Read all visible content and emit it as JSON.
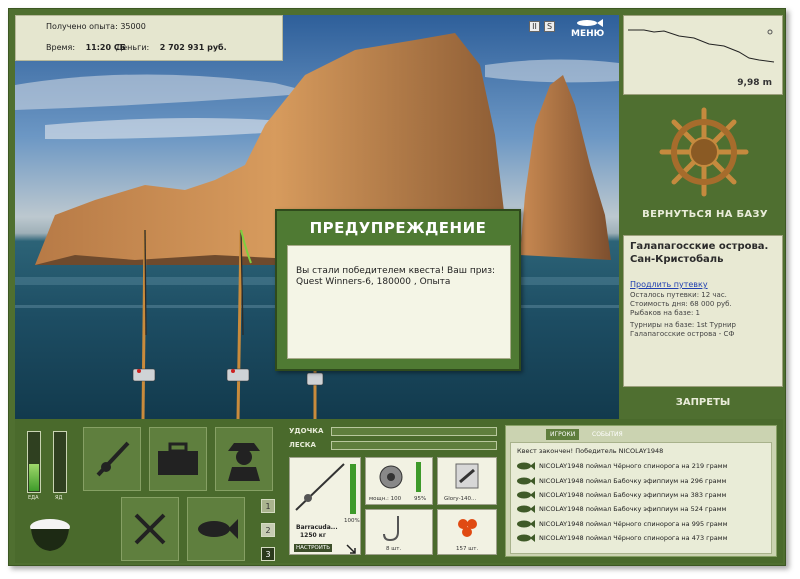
{
  "hud": {
    "experience_label": "Получено опыта:",
    "experience_value": "35000",
    "time_label": "Время:",
    "time_value": "11:20 СБ",
    "money_label": "Деньги:",
    "money_value": "2 702 931 руб.",
    "pause_btn": "II",
    "sound_btn": "S",
    "menu_btn": "МЕНЮ"
  },
  "depth": {
    "value": "9,98 m"
  },
  "right_panel": {
    "return_label": "ВЕРНУТЬСЯ НА БАЗУ",
    "location_title": "Галапагосские острова. Сан-Кристобаль",
    "extend_link": "Продлить путевку",
    "lines": [
      "Осталось путевки: 12 час.",
      "Стоимость дня: 68 000 руб.",
      "Рыбаков на базе: 1",
      "Турниры на базе: 1st Турнир Галапагосские острова - СФ"
    ],
    "bans_label": "ЗАПРЕТЫ"
  },
  "warning": {
    "title": "ПРЕДУПРЕЖДЕНИЕ",
    "message": "Вы стали победителем квеста! Ваш приз: Quest Winners-6, 180000 , Опыта"
  },
  "bottom": {
    "food_label": "ЕДА",
    "poison_label": "ЯД",
    "food_level": 0.45,
    "poison_level": 0.0,
    "page_buttons": [
      "1",
      "2",
      "3"
    ],
    "rod_label": "УДОЧКА",
    "line_label": "ЛЕСКА",
    "rod_name": "Barracuda...",
    "rod_weight": "1250 кг",
    "rod_percent": "100%",
    "setup_btn": "НАСТРОИТЬ",
    "reel_caption": "мощн.: 100",
    "reel_percent": "95%",
    "lure_caption": "Glory-140...",
    "hook_caption": "8 шт.",
    "bait_caption": "157 шт."
  },
  "feed": {
    "tab_players": "ИГРОКИ",
    "tab_events": "СОБЫТИЯ",
    "header": "Квест закончен! Победитель NICOLAY1948",
    "entries": [
      "NICOLAY1948 поймал Чёрного спинорога на 219 грамм",
      "NICOLAY1948 поймал Бабочку эфиппиум на 296 грамм",
      "NICOLAY1948 поймал Бабочку эфиппиум на 383 грамм",
      "NICOLAY1948 поймал Бабочку эфиппиум на 524 грамм",
      "NICOLAY1948 поймал Чёрного спинорога на 995 грамм",
      "NICOLAY1948 поймал Чёрного спинорога на 473 грамм"
    ]
  },
  "colors": {
    "panel_green": "#4f6f30",
    "accent_light": "#e8e9d3"
  }
}
